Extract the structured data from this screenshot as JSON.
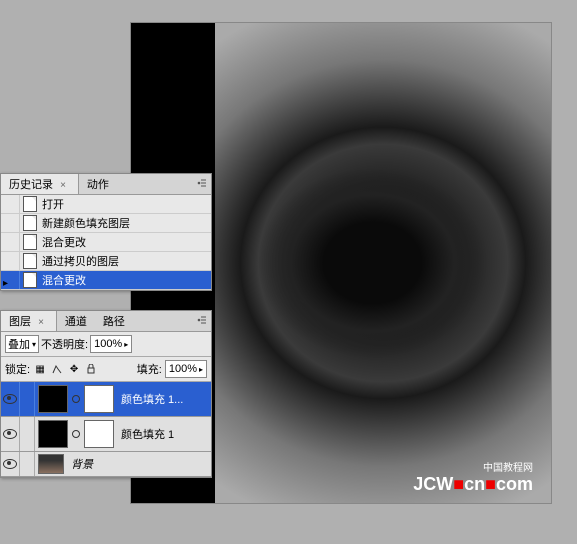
{
  "watermark": {
    "line1": "中国教程网",
    "line2_a": "JCW",
    "line2_b": "cn",
    "line2_c": "com"
  },
  "history": {
    "tab_history": "历史记录",
    "tab_actions": "动作",
    "items": [
      {
        "label": "打开"
      },
      {
        "label": "新建颜色填充图层"
      },
      {
        "label": "混合更改"
      },
      {
        "label": "通过拷贝的图层"
      },
      {
        "label": "混合更改"
      }
    ]
  },
  "layers": {
    "tab_layers": "图层",
    "tab_channels": "通道",
    "tab_paths": "路径",
    "blend_mode": "叠加",
    "opacity_label": "不透明度:",
    "opacity_value": "100%",
    "lock_label": "锁定:",
    "fill_label": "填充:",
    "fill_value": "100%",
    "items": [
      {
        "name": "颜色填充 1..."
      },
      {
        "name": "颜色填充 1"
      },
      {
        "name": "背景"
      }
    ]
  }
}
